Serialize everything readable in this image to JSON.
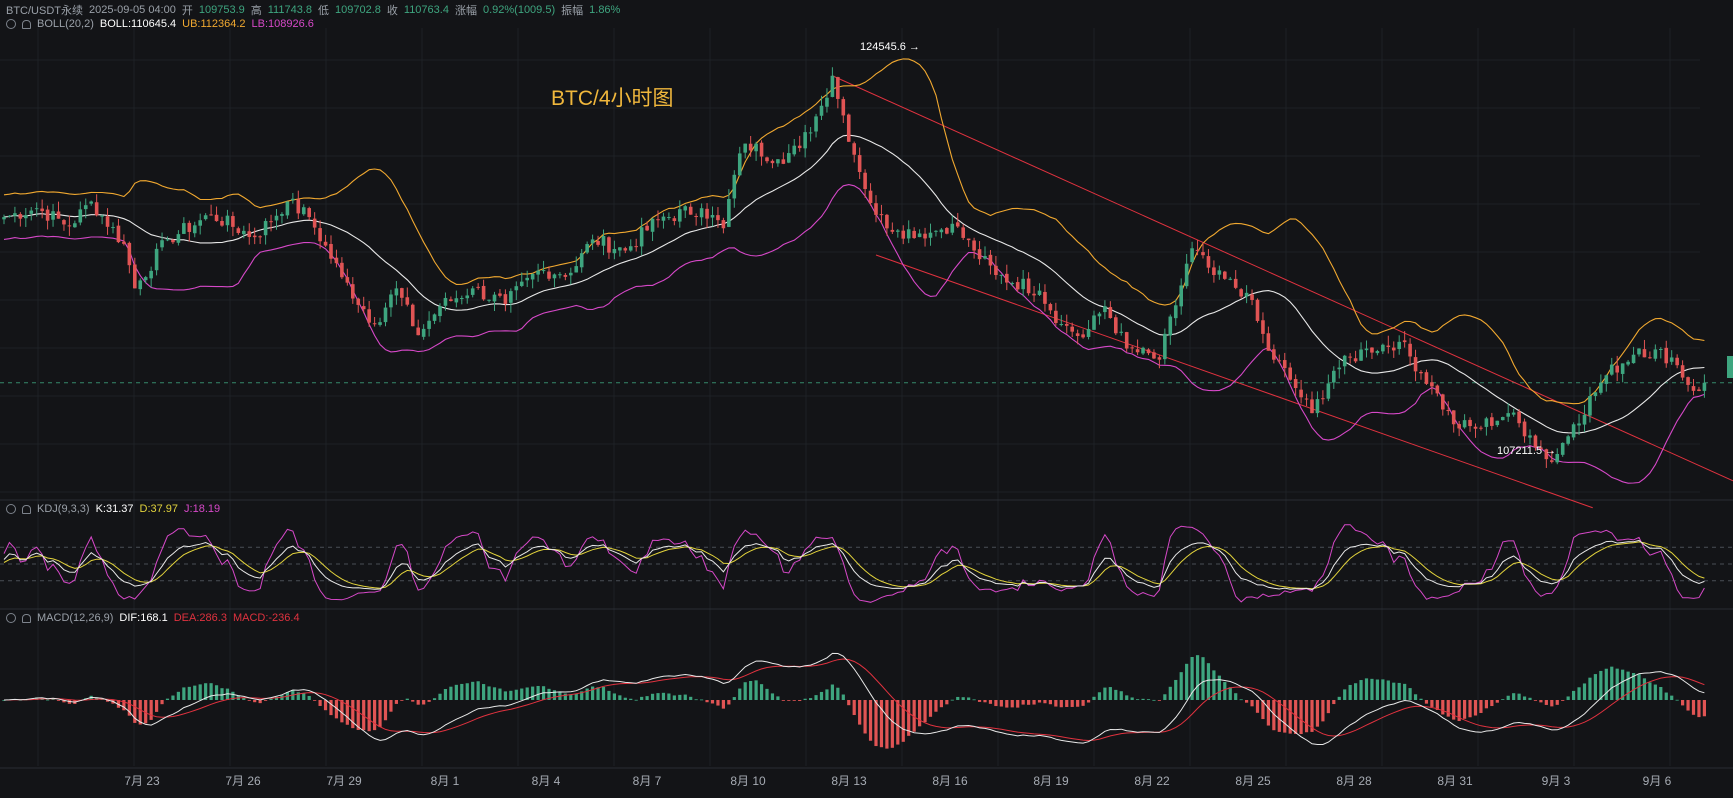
{
  "header": {
    "symbol": "BTC/USDT永续",
    "datetime": "2025-09-05 04:00",
    "open_label": "开",
    "open": "109753.9",
    "high_label": "高",
    "high": "111743.8",
    "low_label": "低",
    "low": "109702.8",
    "close_label": "收",
    "close": "110763.4",
    "change_label": "涨幅",
    "change": "0.92%(1009.5)",
    "amp_label": "振幅",
    "amp": "1.86%"
  },
  "boll": {
    "name": "BOLL(20,2)",
    "mid": "BOLL:110645.4",
    "ub": "UB:112364.2",
    "lb": "LB:108926.6"
  },
  "kdj": {
    "name": "KDJ(9,3,3)",
    "k": "K:31.37",
    "d": "D:37.97",
    "j": "J:18.19"
  },
  "macd": {
    "name": "MACD(12,26,9)",
    "dif": "DIF:168.1",
    "dea": "DEA:286.3",
    "macd": "MACD:-236.4"
  },
  "colors": {
    "up": "#3ea57f",
    "down": "#e05454",
    "upper_band": "#f0a830",
    "mid_band": "#e8e8e8",
    "lower_band": "#d648c8",
    "channel": "#e0323f",
    "k": "#e8e8e8",
    "d": "#e2d33c",
    "j": "#d648c8",
    "dif": "#e8e8e8",
    "dea": "#e0323f"
  },
  "chart_data": {
    "type": "candlestick",
    "title": "BTC/4小时图",
    "annotations": [
      {
        "text": "124545.6 →",
        "price": 124545.6,
        "date": "8月14"
      },
      {
        "text": "107211.5 →",
        "price": 107211.5,
        "date": "9月1"
      }
    ],
    "current_price_line": 110763.4,
    "x_ticks": [
      "7月 23",
      "7月 26",
      "7月 29",
      "8月 1",
      "8月 4",
      "8月 7",
      "8月 10",
      "8月 13",
      "8月 16",
      "8月 19",
      "8月 22",
      "8月 25",
      "8月 28",
      "8月 31",
      "9月 3",
      "9月 6"
    ],
    "series": [
      {
        "name": "BOLL",
        "description": "middle band"
      },
      {
        "name": "UB"
      },
      {
        "name": "LB"
      }
    ],
    "price_anchors": [
      [
        0,
        118200
      ],
      [
        6,
        118600
      ],
      [
        12,
        117800
      ],
      [
        16,
        118900
      ],
      [
        22,
        117000
      ],
      [
        24,
        115000
      ],
      [
        30,
        117200
      ],
      [
        38,
        118300
      ],
      [
        46,
        117300
      ],
      [
        52,
        118900
      ],
      [
        56,
        118200
      ],
      [
        62,
        115500
      ],
      [
        68,
        113400
      ],
      [
        72,
        115000
      ],
      [
        76,
        112900
      ],
      [
        80,
        114200
      ],
      [
        86,
        115000
      ],
      [
        92,
        114300
      ],
      [
        98,
        115800
      ],
      [
        104,
        115700
      ],
      [
        108,
        117200
      ],
      [
        114,
        116700
      ],
      [
        120,
        118100
      ],
      [
        128,
        118600
      ],
      [
        132,
        117700
      ],
      [
        134,
        120100
      ],
      [
        136,
        121500
      ],
      [
        142,
        120800
      ],
      [
        146,
        121300
      ],
      [
        150,
        123200
      ],
      [
        152,
        124545.6
      ],
      [
        156,
        121000
      ],
      [
        160,
        118300
      ],
      [
        164,
        117600
      ],
      [
        170,
        117500
      ],
      [
        174,
        117900
      ],
      [
        178,
        116700
      ],
      [
        182,
        115600
      ],
      [
        190,
        114900
      ],
      [
        194,
        113400
      ],
      [
        198,
        112800
      ],
      [
        202,
        114200
      ],
      [
        206,
        112300
      ],
      [
        212,
        111800
      ],
      [
        218,
        116800
      ],
      [
        222,
        115600
      ],
      [
        228,
        114800
      ],
      [
        232,
        112200
      ],
      [
        236,
        110900
      ],
      [
        240,
        109400
      ],
      [
        244,
        111300
      ],
      [
        250,
        112300
      ],
      [
        256,
        112600
      ],
      [
        262,
        110600
      ],
      [
        266,
        108900
      ],
      [
        270,
        108700
      ],
      [
        276,
        109400
      ],
      [
        280,
        108400
      ],
      [
        284,
        107211.5
      ],
      [
        288,
        108900
      ],
      [
        294,
        111100
      ],
      [
        300,
        112300
      ],
      [
        306,
        111900
      ],
      [
        310,
        110400
      ],
      [
        312,
        110763.4
      ]
    ],
    "y_range": [
      105500,
      126600
    ],
    "kdj_range": [
      -25,
      125
    ],
    "kdj_levels": [
      20,
      50,
      80
    ],
    "macd_range": [
      -1900,
      1900
    ]
  }
}
